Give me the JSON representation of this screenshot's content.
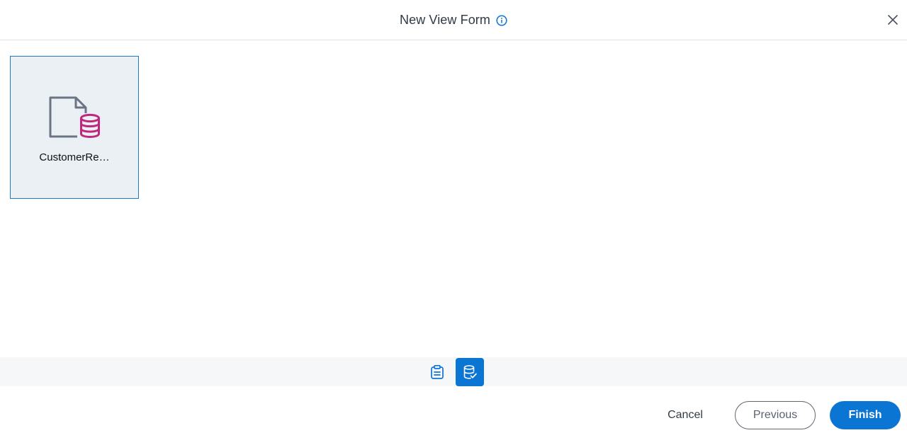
{
  "dialog": {
    "title": "New View Form",
    "title_icon": "info-icon",
    "close_icon": "close-icon"
  },
  "tiles": [
    {
      "label": "CustomerRe…",
      "icon": "form-database-icon",
      "selected": true
    }
  ],
  "steps": [
    {
      "icon": "clipboard-icon",
      "active": false
    },
    {
      "icon": "database-check-icon",
      "active": true
    }
  ],
  "footer": {
    "cancel_label": "Cancel",
    "previous_label": "Previous",
    "finish_label": "Finish"
  },
  "colors": {
    "accent": "#0b75d4",
    "tile_selected_bg": "#eaf0f4",
    "tile_selected_border": "#1f7bc1",
    "database_icon": "#c0277e",
    "document_icon": "#6b7485"
  }
}
